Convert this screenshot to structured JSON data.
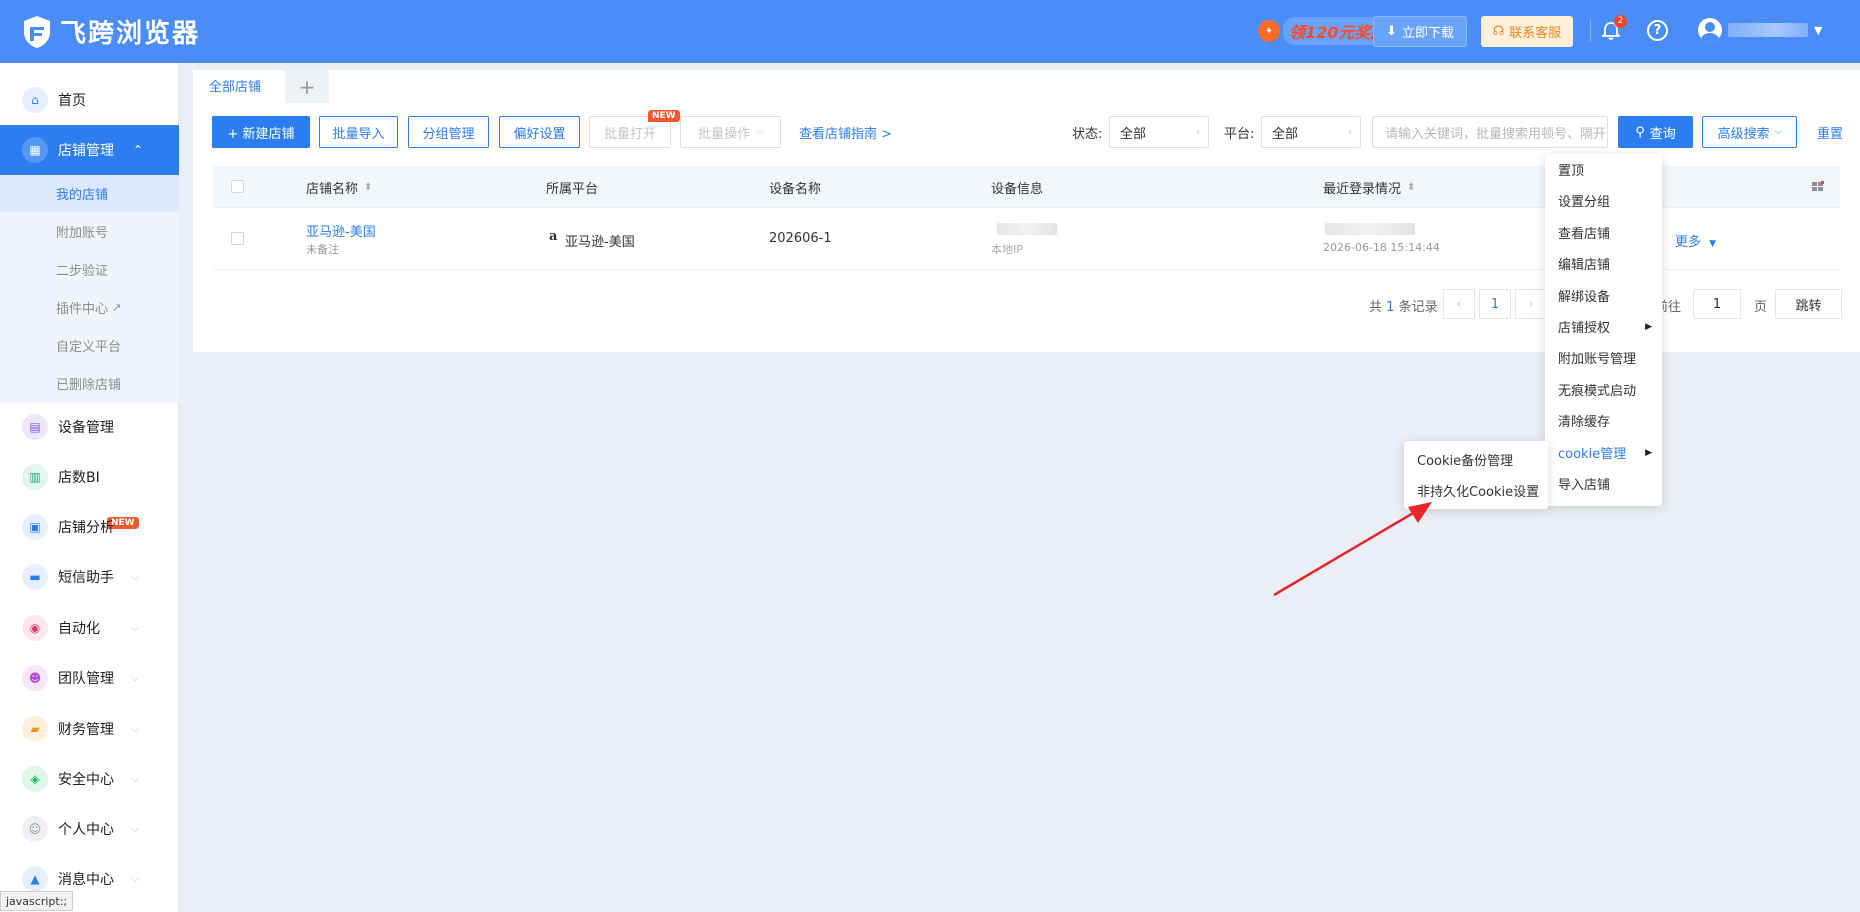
{
  "app": {
    "logo_text": "飞跨浏览器",
    "promo_text": "领120元奖励",
    "download_label": "立即下载",
    "support_label": "联系客服",
    "notification_count": "2",
    "help_glyph": "?"
  },
  "sidebar": {
    "home": "首页",
    "store_mgmt": "店铺管理",
    "sub_items": [
      "我的店铺",
      "附加账号",
      "二步验证",
      "插件中心",
      "自定义平台",
      "已删除店铺"
    ],
    "device_mgmt": "设备管理",
    "store_bi": "店数BI",
    "new_tag": "NEW",
    "store_analysis": "店铺分析",
    "sms_assistant": "短信助手",
    "automation": "自动化",
    "team_mgmt": "团队管理",
    "finance_mgmt": "财务管理",
    "security_center": "安全中心",
    "personal_center": "个人中心",
    "message_center": "消息中心"
  },
  "tabs": {
    "all_stores": "全部店铺",
    "add": "+"
  },
  "toolbar": {
    "new_store": "+ 新建店铺",
    "batch_import": "批量导入",
    "group_mgmt": "分组管理",
    "preference": "偏好设置",
    "batch_open": "批量打开",
    "batch_ops": "批量操作",
    "guide_link": "查看店铺指南 >",
    "new_tag": "NEW",
    "status_label": "状态:",
    "status_value": "全部",
    "platform_label": "平台:",
    "platform_value": "全部",
    "search_placeholder": "请输入关键词，批量搜索用顿号、隔开",
    "query": "查询",
    "advanced_search": "高级搜索",
    "reset": "重置"
  },
  "table": {
    "headers": [
      "店铺名称",
      "所属平台",
      "设备名称",
      "设备信息",
      "最近登录情况"
    ],
    "row": {
      "store_name": "亚马逊-美国",
      "note": "未备注",
      "platform_glyph": "a",
      "platform": "亚马逊-美国",
      "device_name": "202606-1",
      "device_ip_label": "本地IP",
      "login_time": "2026-06-18 15:14:44",
      "more": "更多"
    }
  },
  "pagination": {
    "total_prefix": "共",
    "total": "1",
    "total_suffix": "条记录",
    "current": "1",
    "goto_label": "前往",
    "goto_value": "1",
    "page_label": "页",
    "jump": "跳转"
  },
  "context_menu": [
    "置顶",
    "设置分组",
    "查看店铺",
    "编辑店铺",
    "解绑设备",
    "店铺授权",
    "附加账号管理",
    "无痕模式启动",
    "清除缓存",
    "cookie管理",
    "导入店铺"
  ],
  "cookie_submenu": [
    "Cookie备份管理",
    "非持久化Cookie设置"
  ],
  "statusbar": "javascript:;",
  "colors": {
    "header_bg": "#4a8df8",
    "accent": "#2c7ef0",
    "new_tag": "#f5582e",
    "arrow": "#e8242c"
  }
}
